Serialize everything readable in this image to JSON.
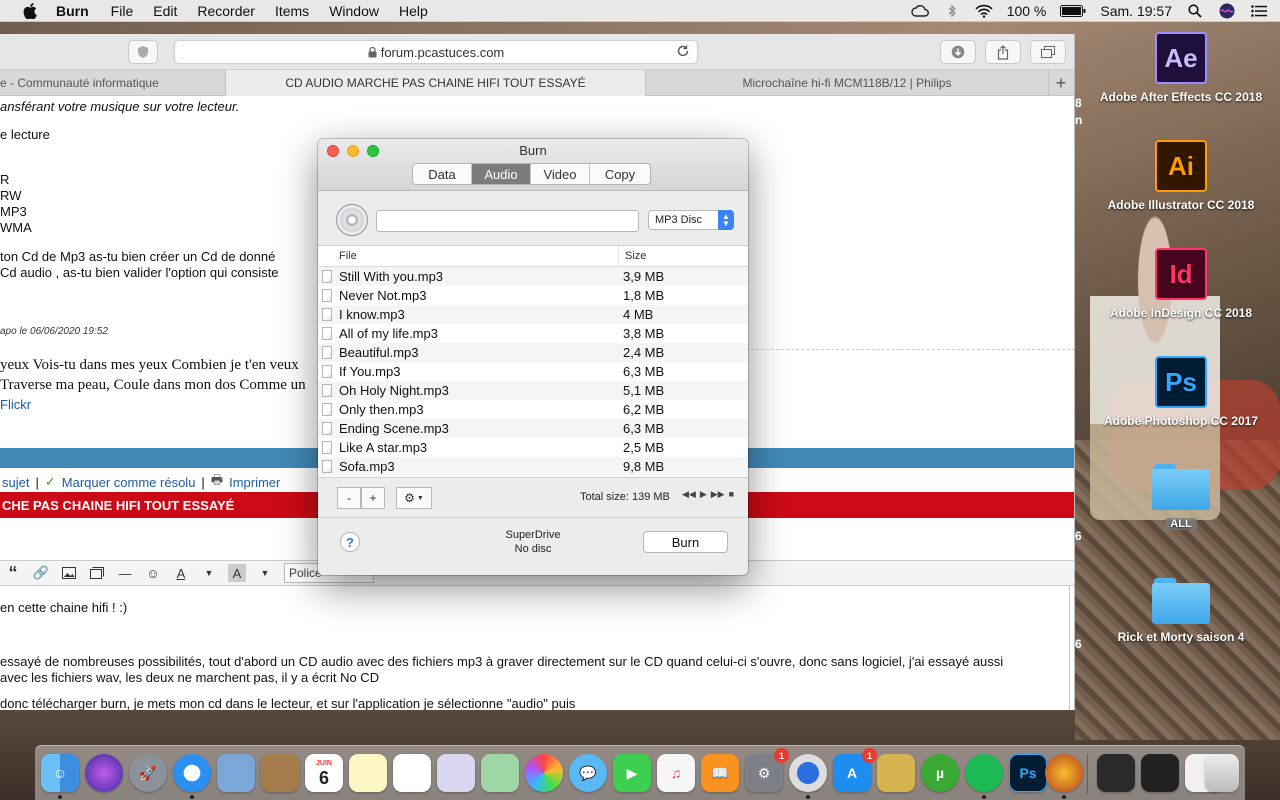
{
  "menubar": {
    "app_name": "Burn",
    "items": [
      "File",
      "Edit",
      "Recorder",
      "Items",
      "Window",
      "Help"
    ],
    "battery": "100 %",
    "clock": "Sam. 19:57"
  },
  "safari": {
    "url": "forum.pcastuces.com",
    "tabs": [
      "e - Communauté informatique",
      "CD AUDIO MARCHE PAS CHAINE HIFI TOUT ESSAYÉ",
      "Microchaîne hi-fi MCM118B/12 | Philips"
    ],
    "page": {
      "line1": "ansférant votre musique sur votre lecteur.",
      "line2": "e lecture",
      "list": [
        "R",
        "RW",
        "MP3",
        "WMA"
      ],
      "line3": "ton Cd de Mp3 as-tu bien créer un Cd de donné",
      "line4": "Cd audio , as-tu bien valider l'option qui consiste",
      "meta": "apo le 06/06/2020 19:52",
      "quote1": "yeux Vois-tu dans mes yeux Combien je t'en veux",
      "quote2": "Traverse ma peau, Coule dans mon dos Comme un",
      "flickr": "Flickr",
      "actions_sujet": "sujet",
      "actions_resolu": "Marquer comme résolu",
      "actions_print": "Imprimer",
      "red_title": "CHE PAS CHAINE HIFI TOUT ESSAYÉ",
      "font_select": "Police",
      "body1": "en cette chaine hifi ! :)",
      "body2": "essayé de nombreuses possibilités, tout d'abord un CD audio avec des fichiers mp3 à graver directement sur le CD quand celui-ci s'ouvre, donc sans logiciel, j'ai essayé aussi",
      "body3": "avec les fichiers wav, les deux ne marchent pas, il y a écrit No CD",
      "body4": "donc télécharger burn, je mets mon cd dans le lecteur, et sur l'application je sélectionne \"audio\" puis"
    }
  },
  "desktop": {
    "icons": [
      {
        "tile": "Ae",
        "label": "Adobe After Effects CC 2018"
      },
      {
        "tile": "Ai",
        "label": "Adobe Illustrator CC 2018"
      },
      {
        "tile": "Id",
        "label": "Adobe InDesign CC 2018"
      },
      {
        "tile": "Ps",
        "label": "Adobe Photoshop CC 2017"
      },
      {
        "tag": "ALL",
        "label": ""
      },
      {
        "label": "Rick et Morty saison 4"
      }
    ],
    "edge_text": [
      "8",
      "n",
      "6",
      "6"
    ]
  },
  "burn": {
    "title": "Burn",
    "tabs": [
      "Data",
      "Audio",
      "Video",
      "Copy"
    ],
    "active_tab": "Audio",
    "disc_name": "",
    "disc_type": "MP3 Disc",
    "columns": {
      "file": "File",
      "size": "Size"
    },
    "files": [
      {
        "name": "Still With you.mp3",
        "size": "3,9 MB"
      },
      {
        "name": "Never Not.mp3",
        "size": "1,8 MB"
      },
      {
        "name": "I know.mp3",
        "size": "4 MB"
      },
      {
        "name": "All of my life.mp3",
        "size": "3,8 MB"
      },
      {
        "name": "Beautiful.mp3",
        "size": "2,4 MB"
      },
      {
        "name": "If You.mp3",
        "size": "6,3 MB"
      },
      {
        "name": "Oh Holy Night.mp3",
        "size": "5,1 MB"
      },
      {
        "name": "Only then.mp3",
        "size": "6,2 MB"
      },
      {
        "name": "Ending Scene.mp3",
        "size": "6,3 MB"
      },
      {
        "name": "Like A star.mp3",
        "size": "2,5 MB"
      },
      {
        "name": "Sofa.mp3",
        "size": "9,8 MB"
      }
    ],
    "remove_label": "-",
    "add_label": "+",
    "total": "Total size: 139 MB",
    "drive_name": "SuperDrive",
    "drive_status": "No disc",
    "help_label": "?",
    "burn_label": "Burn"
  },
  "dock": {
    "calendar_month": "JUIN",
    "calendar_day": "6",
    "badges": {
      "sysprefs": "1",
      "appstore": "1"
    }
  }
}
